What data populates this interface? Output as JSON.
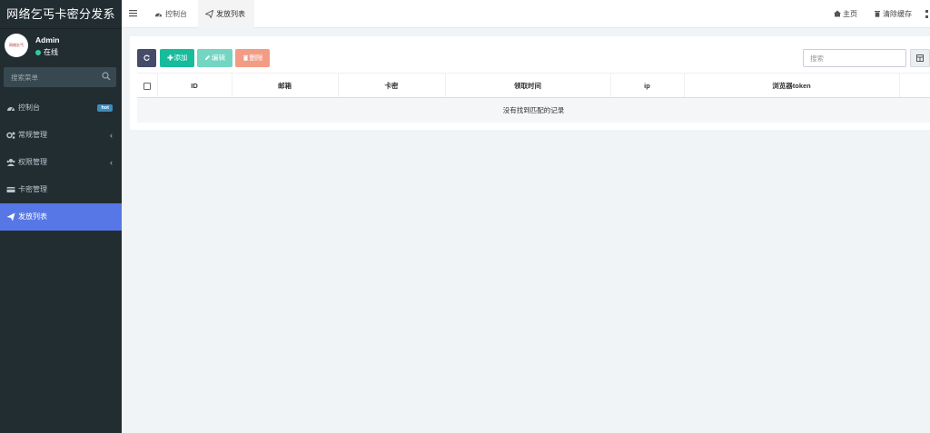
{
  "app": {
    "brand": "网络乞丐卡密分发系",
    "logo_text": "网络乞丐"
  },
  "user": {
    "name": "Admin",
    "status": "在线"
  },
  "sidebar": {
    "search_placeholder": "搜索菜单",
    "items": [
      {
        "label": "控制台",
        "icon": "dashboard-icon",
        "badge": "hot"
      },
      {
        "label": "常规管理",
        "icon": "cogs-icon",
        "chevron": "‹"
      },
      {
        "label": "权限管理",
        "icon": "users-icon",
        "chevron": "‹"
      },
      {
        "label": "卡密管理",
        "icon": "card-icon"
      },
      {
        "label": "发放列表",
        "icon": "send-icon",
        "active": true
      }
    ]
  },
  "header": {
    "tabs": [
      {
        "label": "控制台",
        "icon": "dashboard-icon"
      },
      {
        "label": "发放列表",
        "icon": "send-icon",
        "active": true
      }
    ],
    "home_label": "主页",
    "clear_cache_label": "清除缓存"
  },
  "toolbar": {
    "add_label": "添加",
    "edit_label": "编辑",
    "delete_label": "删除",
    "search_placeholder": "搜索"
  },
  "table": {
    "columns": [
      "ID",
      "邮箱",
      "卡密",
      "领取时间",
      "ip",
      "浏览器token"
    ],
    "empty_text": "没有找到匹配的记录"
  },
  "colors": {
    "sidebar_bg": "#222d32",
    "active_menu": "#5677e5",
    "add_button": "#18bc9c",
    "edit_button": "#74d5c2",
    "delete_button": "#f39c85",
    "refresh_button": "#444c69"
  }
}
